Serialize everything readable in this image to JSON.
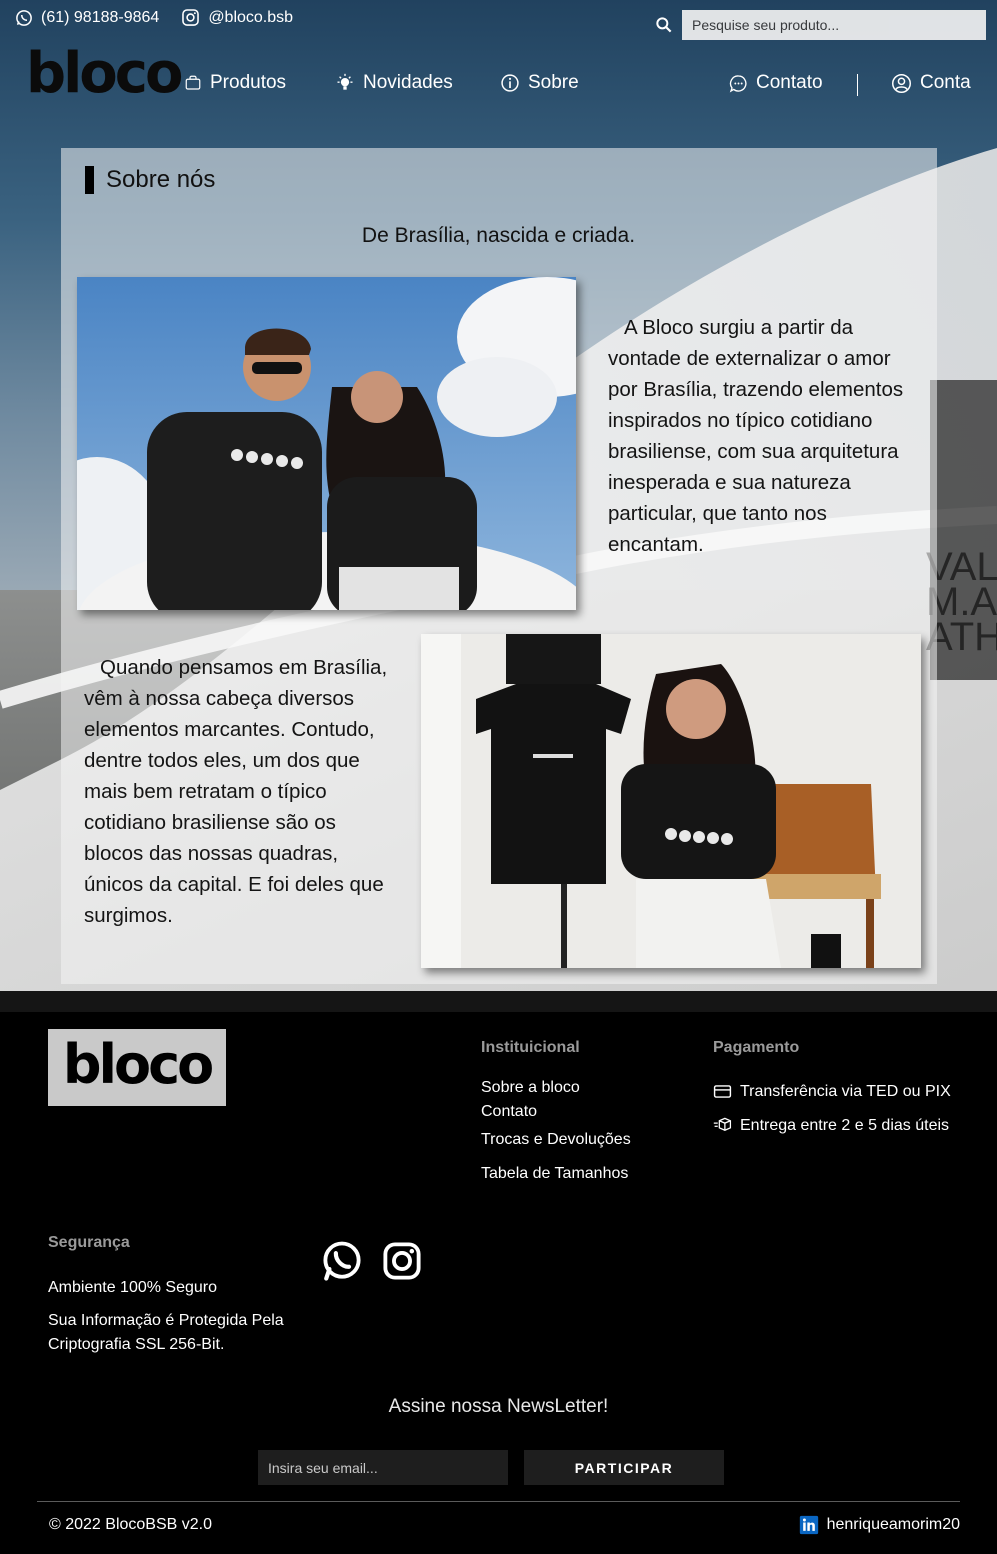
{
  "topbar": {
    "phone": "(61) 98188-9864",
    "instagram": "@bloco.bsb",
    "search_placeholder": "Pesquise seu produto..."
  },
  "nav": {
    "logo": "bloco",
    "items": [
      {
        "label": "Produtos",
        "icon": "bag-icon"
      },
      {
        "label": "Novidades",
        "icon": "lightbulb-icon"
      },
      {
        "label": "Sobre",
        "icon": "info-icon"
      },
      {
        "label": "Contato",
        "icon": "chat-icon"
      },
      {
        "label": "Conta",
        "icon": "user-icon"
      }
    ]
  },
  "about": {
    "title": "Sobre nós",
    "subtitle": "De Brasília, nascida e criada.",
    "paragraph1": "A Bloco surgiu a partir da vontade de externalizar o amor por Brasília, trazendo elementos inspirados no típico cotidiano brasiliense, com sua arquitetura inesperada e sua natureza particular, que tanto nos encantam.",
    "paragraph2": "Quando pensamos em Brasília, vêm à nossa cabeça diversos elementos marcantes. Contudo, dentre todos eles, um dos que mais bem retratam o típico cotidiano brasiliense são os blocos das nossas quadras, únicos da capital. E foi deles que surgimos."
  },
  "footer": {
    "logo": "bloco",
    "institutional": {
      "title": "Instituicional",
      "links": [
        "Sobre a bloco",
        "Contato",
        "Trocas e Devoluções",
        "Tabela de Tamanhos"
      ]
    },
    "payment": {
      "title": "Pagamento",
      "items": [
        {
          "label": "Transferência via TED ou PIX",
          "icon": "card-icon"
        },
        {
          "label": "Entrega entre 2 e 5 dias úteis",
          "icon": "delivery-box-icon"
        }
      ]
    },
    "security": {
      "title": "Segurança",
      "line1": "Ambiente 100% Seguro",
      "line2": "Sua Informação é Protegida Pela Criptografia SSL 256-Bit."
    },
    "newsletter": {
      "title": "Assine nossa NewsLetter!",
      "placeholder": "Insira seu email...",
      "button": "PARTICIPAR"
    },
    "copyright": "© 2022 BlocoBSB v2.0",
    "linkedin": "henriqueamorim20"
  },
  "colors": {
    "hero_top": "#21425f",
    "card_bg": "#f4f4f4",
    "footer_bg": "#000000",
    "linkedin_blue": "#0a66c2"
  }
}
